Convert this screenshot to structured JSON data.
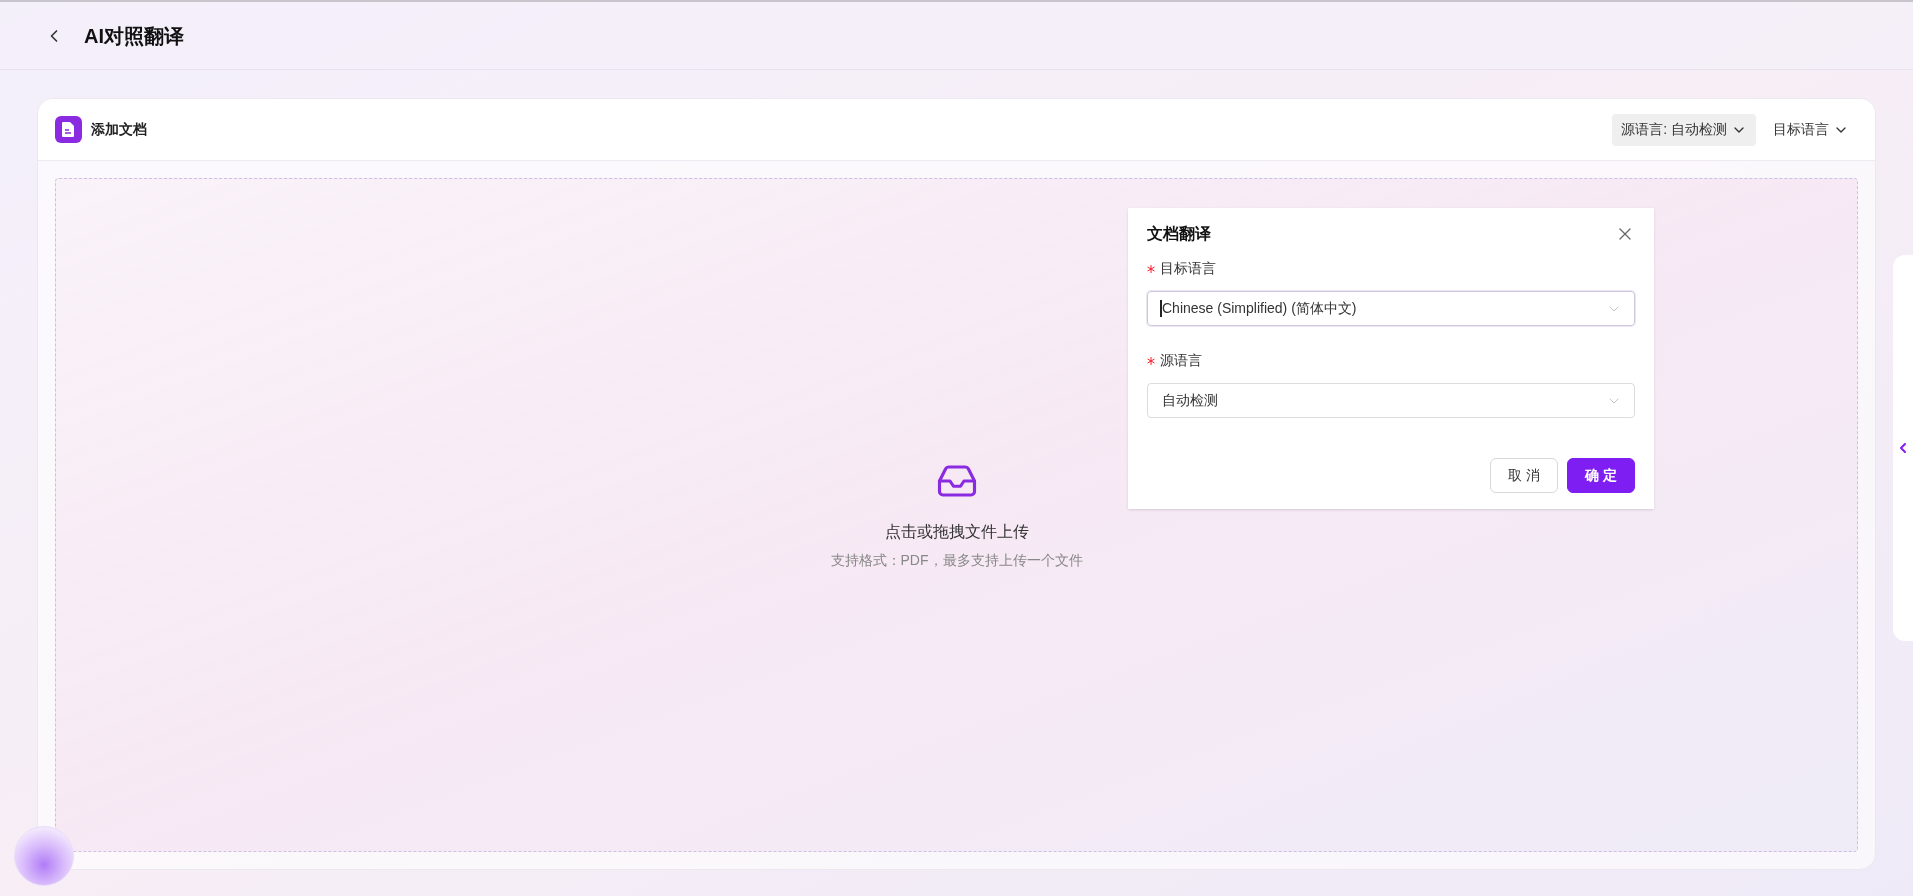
{
  "header": {
    "title": "AI对照翻译"
  },
  "card": {
    "title": "添加文档",
    "language_buttons": [
      {
        "label": "源语言: 自动检测",
        "selected": true
      },
      {
        "label": "目标语言",
        "selected": false
      }
    ]
  },
  "upload": {
    "text": "点击或拖拽文件上传",
    "hint": "支持格式：PDF，最多支持上传一个文件"
  },
  "dialog": {
    "title": "文档翻译",
    "fields": [
      {
        "label": "目标语言",
        "required": true,
        "value": "Chinese (Simplified) (简体中文)",
        "focused": true
      },
      {
        "label": "源语言",
        "required": true,
        "value": "自动检测",
        "focused": false
      }
    ],
    "buttons": [
      {
        "label": "取 消",
        "kind": "secondary"
      },
      {
        "label": "确 定",
        "kind": "primary"
      }
    ]
  }
}
